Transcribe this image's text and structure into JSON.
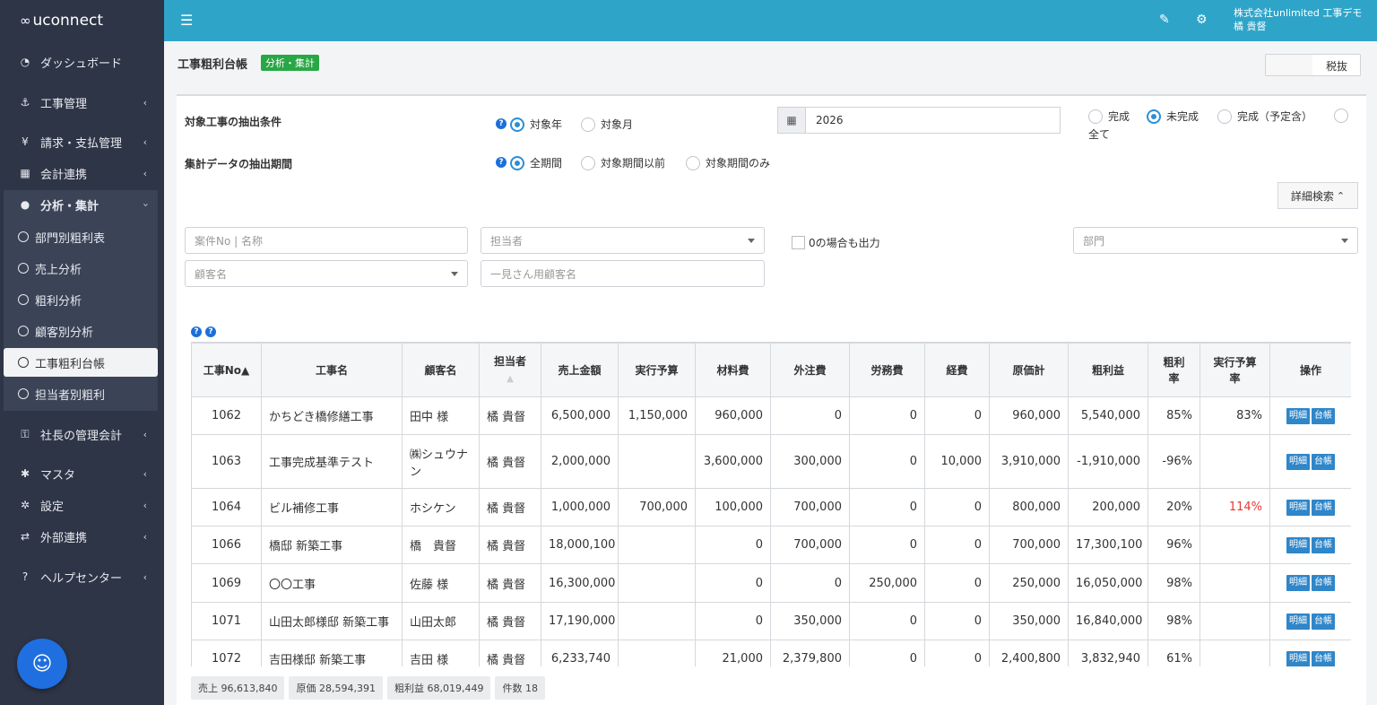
{
  "app": {
    "logo_text": "uconnect"
  },
  "sidebar": {
    "items": [
      {
        "label": "ダッシュボード",
        "icon": "gauge-icon"
      },
      {
        "label": "工事管理",
        "icon": "anchor-icon"
      },
      {
        "label": "請求・支払管理",
        "icon": "yen-icon"
      },
      {
        "label": "会計連携",
        "icon": "calculator-icon"
      },
      {
        "label": "分析・集計",
        "icon": "drop-icon"
      },
      {
        "label": "社長の管理会計",
        "icon": "key-icon"
      },
      {
        "label": "マスタ",
        "icon": "gear-icon"
      },
      {
        "label": "設定",
        "icon": "gears-icon"
      },
      {
        "label": "外部連携",
        "icon": "exchange-icon"
      },
      {
        "label": "ヘルプセンター",
        "icon": "question-icon"
      }
    ],
    "sub_items": [
      {
        "label": "部門別粗利表"
      },
      {
        "label": "売上分析"
      },
      {
        "label": "粗利分析"
      },
      {
        "label": "顧客別分析"
      },
      {
        "label": "工事粗利台帳"
      },
      {
        "label": "担当者別粗利"
      }
    ]
  },
  "topbar": {
    "company_name": "株式会社unlimited 工事デモ",
    "user_name": "橘 貴督"
  },
  "header": {
    "title": "工事粗利台帳",
    "badge": "分析・集計",
    "tax_toggle_label": "税抜"
  },
  "filters": {
    "condition_label": "対象工事の抽出条件",
    "period_label": "集計データの抽出期間",
    "condition_options": [
      "対象年",
      "対象月"
    ],
    "period_options": [
      "全期間",
      "対象期間以前",
      "対象期間のみ"
    ],
    "year_value": "2026",
    "status_options": [
      "完成",
      "未完成",
      "完成（予定含）",
      "全て"
    ],
    "advanced_search_label": "詳細検索",
    "case_placeholder": "案件No | 名称",
    "staff_placeholder": "担当者",
    "zero_output_label": "0の場合も出力",
    "dept_placeholder": "部門",
    "customer_placeholder": "顧客名",
    "one_time_customer_placeholder": "一見さん用顧客名"
  },
  "table": {
    "headers": {
      "no": "工事No▲",
      "name": "工事名",
      "customer": "顧客名",
      "staff": "担当者",
      "staff_sort": "▲",
      "sales": "売上金額",
      "budget": "実行予算",
      "material": "材料費",
      "outsource": "外注費",
      "labor": "労務費",
      "expense": "経費",
      "cost": "原価計",
      "profit": "粗利益",
      "rate_l1": "粗利",
      "rate_l2": "率",
      "budget_rate_l1": "実行予算",
      "budget_rate_l2": "率",
      "ops": "操作"
    },
    "btn_detail": "明細",
    "btn_ledger": "台帳",
    "rows": [
      {
        "no": "1062",
        "name": "かちどき橋修繕工事",
        "customer": "田中 様",
        "staff": "橘 貴督",
        "sales": "6,500,000",
        "budget": "1,150,000",
        "material": "960,000",
        "outsource": "0",
        "labor": "0",
        "expense": "0",
        "cost": "960,000",
        "profit": "5,540,000",
        "rate": "85%",
        "budget_rate": "83%"
      },
      {
        "no": "1063",
        "name": "工事完成基準テスト",
        "customer": "㈱シュウナン",
        "staff": "橘 貴督",
        "sales": "2,000,000",
        "budget": "",
        "material": "3,600,000",
        "outsource": "300,000",
        "labor": "0",
        "expense": "10,000",
        "cost": "3,910,000",
        "profit": "-1,910,000",
        "rate": "-96%",
        "budget_rate": ""
      },
      {
        "no": "1064",
        "name": "ビル補修工事",
        "customer": "ホシケン",
        "staff": "橘 貴督",
        "sales": "1,000,000",
        "budget": "700,000",
        "material": "100,000",
        "outsource": "700,000",
        "labor": "0",
        "expense": "0",
        "cost": "800,000",
        "profit": "200,000",
        "rate": "20%",
        "budget_rate": "114%"
      },
      {
        "no": "1066",
        "name": "橋邸 新築工事",
        "customer": "橋　貴督",
        "staff": "橘 貴督",
        "sales": "18,000,100",
        "budget": "",
        "material": "0",
        "outsource": "700,000",
        "labor": "0",
        "expense": "0",
        "cost": "700,000",
        "profit": "17,300,100",
        "rate": "96%",
        "budget_rate": ""
      },
      {
        "no": "1069",
        "name": "〇〇工事",
        "customer": "佐藤 様",
        "staff": "橘 貴督",
        "sales": "16,300,000",
        "budget": "",
        "material": "0",
        "outsource": "0",
        "labor": "250,000",
        "expense": "0",
        "cost": "250,000",
        "profit": "16,050,000",
        "rate": "98%",
        "budget_rate": ""
      },
      {
        "no": "1071",
        "name": "山田太郎様邸 新築工事",
        "customer": "山田太郎",
        "staff": "橘 貴督",
        "sales": "17,190,000",
        "budget": "",
        "material": "0",
        "outsource": "350,000",
        "labor": "0",
        "expense": "0",
        "cost": "350,000",
        "profit": "16,840,000",
        "rate": "98%",
        "budget_rate": ""
      },
      {
        "no": "1072",
        "name": "吉田様邸 新築工事",
        "customer": "吉田 様",
        "staff": "橘 貴督",
        "sales": "6,233,740",
        "budget": "",
        "material": "21,000",
        "outsource": "2,379,800",
        "labor": "0",
        "expense": "0",
        "cost": "2,400,800",
        "profit": "3,832,940",
        "rate": "61%",
        "budget_rate": ""
      }
    ]
  },
  "summary": {
    "sales": "売上 96,613,840",
    "cost": "原価 28,594,391",
    "profit": "粗利益 68,019,449",
    "count": "件数 18"
  },
  "colors": {
    "topbar": "#2fa4c9",
    "sidebar": "#2e3547",
    "accent": "#2a8fd6",
    "badge": "#28a745",
    "alert": "#e53935"
  }
}
